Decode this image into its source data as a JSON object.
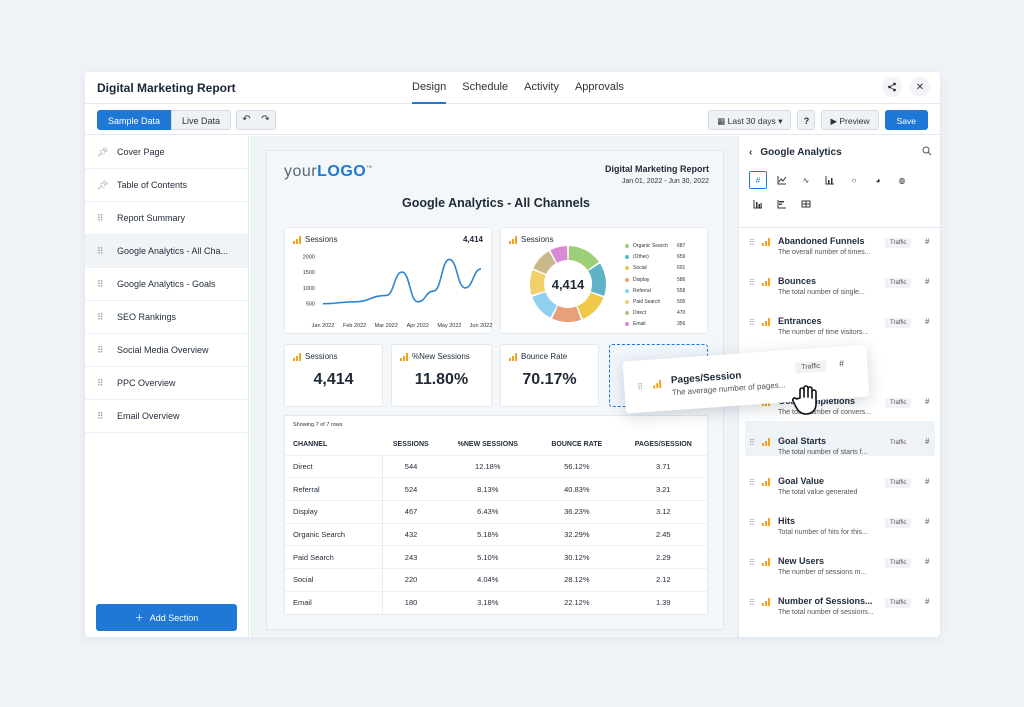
{
  "app": {
    "title": "Digital Marketing Report"
  },
  "tabs": [
    "Design",
    "Schedule",
    "Activity",
    "Approvals"
  ],
  "topbar_icons": [
    "share-icon",
    "close-icon"
  ],
  "toolbar": {
    "sample_data": "Sample Data",
    "live_data": "Live Data",
    "date_range": "Last 30 days",
    "help": "?",
    "preview": "Preview",
    "save": "Save"
  },
  "sidebar": {
    "items": [
      {
        "label": "Cover Page",
        "icon": "pin-icon"
      },
      {
        "label": "Table of Contents",
        "icon": "pin-icon"
      },
      {
        "label": "Report Summary",
        "icon": "drag-handle-icon"
      },
      {
        "label": "Google Analytics - All Cha...",
        "icon": "drag-handle-icon"
      },
      {
        "label": "Google Analytics - Goals",
        "icon": "drag-handle-icon"
      },
      {
        "label": "SEO Rankings",
        "icon": "drag-handle-icon"
      },
      {
        "label": "Social Media Overview",
        "icon": "drag-handle-icon"
      },
      {
        "label": "PPC Overview",
        "icon": "drag-handle-icon"
      },
      {
        "label": "Email Overview",
        "icon": "drag-handle-icon"
      }
    ],
    "add_section": "Add Section"
  },
  "report": {
    "logo_prefix": "your",
    "logo_bold": "LOGO",
    "logo_tm": "™",
    "title": "Digital Marketing Report",
    "date_range": "Jan 01, 2022 - Jun 30, 2022",
    "heading": "Google Analytics - All Channels",
    "sessions_chart": {
      "label": "Sessions",
      "total": "4,414"
    },
    "donut": {
      "label": "Sessions",
      "center": "4,414"
    },
    "kpis": [
      {
        "label": "Sessions",
        "value": "4,414"
      },
      {
        "label": "%New Sessions",
        "value": "11.80%"
      },
      {
        "label": "Bounce Rate",
        "value": "70.17%"
      }
    ],
    "table": {
      "note": "Showing 7 of 7 rows",
      "headers": [
        "CHANNEL",
        "SESSIONS",
        "%NEW SESSIONS",
        "BOUNCE RATE",
        "PAGES/SESSION"
      ],
      "rows": [
        [
          "Direct",
          "544",
          "12.18%",
          "56.12%",
          "3.71"
        ],
        [
          "Referral",
          "524",
          "8.13%",
          "40.83%",
          "3.21"
        ],
        [
          "Display",
          "467",
          "6.43%",
          "36.23%",
          "3.12"
        ],
        [
          "Organic Search",
          "432",
          "5.18%",
          "32.29%",
          "2.45"
        ],
        [
          "Paid Search",
          "243",
          "5.10%",
          "30.12%",
          "2.29"
        ],
        [
          "Social",
          "220",
          "4.04%",
          "28.12%",
          "2.12"
        ],
        [
          "Email",
          "180",
          "3.18%",
          "22.12%",
          "1.39"
        ]
      ]
    }
  },
  "right_panel": {
    "title": "Google Analytics",
    "viz_icons": [
      "number-icon",
      "line-chart-icon",
      "sparkline-icon",
      "bar-chart-icon",
      "donut-icon",
      "pie-icon",
      "globe-icon",
      "column-chart-icon",
      "horizontal-bar-icon",
      "table-icon"
    ],
    "metrics": [
      {
        "name": "Abandoned Funnels",
        "desc": "The overall number of times...",
        "tag": "Traffic"
      },
      {
        "name": "Bounces",
        "desc": "The total number of single...",
        "tag": "Traffic"
      },
      {
        "name": "Entrances",
        "desc": "The number of time visitors...",
        "tag": "Traffic"
      },
      {
        "name": "Goal Completions",
        "desc": "The total number of convers...",
        "tag": "Traffic"
      },
      {
        "name": "Goal Starts",
        "desc": "The total number of starts f...",
        "tag": "Traffic"
      },
      {
        "name": "Goal Value",
        "desc": "The total value generated",
        "tag": "Traffic"
      },
      {
        "name": "Hits",
        "desc": "Total number of hits for this...",
        "tag": "Traffic"
      },
      {
        "name": "New Users",
        "desc": "The number of sessions m...",
        "tag": "Traffic"
      },
      {
        "name": "Number of Sessions...",
        "desc": "The total number of sessions...",
        "tag": "Traffic"
      }
    ],
    "dragging": {
      "name": "Pages/Session",
      "desc": "The average number of pages...",
      "tag": "Traffic"
    }
  },
  "chart_data": [
    {
      "type": "line",
      "title": "Sessions",
      "x": [
        "Jan 2022",
        "Feb 2022",
        "Mar 2022",
        "Apr 2022",
        "May 2022",
        "Jun 2022"
      ],
      "yticks": [
        "500",
        "1000",
        "1500",
        "2000"
      ],
      "ylim": [
        300,
        2200
      ],
      "series": [
        {
          "values": [
            500,
            560,
            760,
            1500,
            560,
            900,
            1900,
            1000,
            1600
          ]
        }
      ],
      "series_x_index": [
        0,
        1,
        2,
        2.5,
        3,
        3.5,
        4,
        4.5,
        5
      ],
      "color": "#2a86d0",
      "grid": false
    },
    {
      "type": "pie",
      "title": "Sessions",
      "center_label": "4,414",
      "categories": [
        "Organic Search",
        "(Other)",
        "Social",
        "Display",
        "Referral",
        "Paid Search",
        "Direct",
        "Email"
      ],
      "values": [
        687,
        659,
        601,
        586,
        558,
        505,
        470,
        356
      ],
      "colors": [
        "#9dcf77",
        "#5fb3c7",
        "#f0c94a",
        "#e8a07a",
        "#8fd0f0",
        "#f0d06a",
        "#c8b98a",
        "#d88ad2"
      ]
    }
  ],
  "dates_range": {
    "value": "Last 30 days"
  }
}
